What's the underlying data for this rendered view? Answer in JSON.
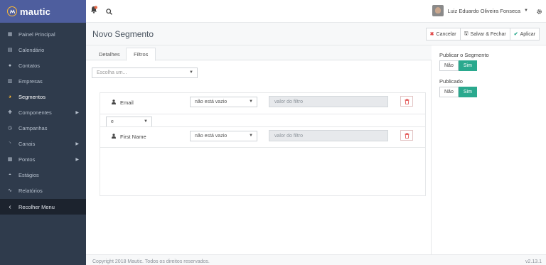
{
  "brand": {
    "name": "mautic"
  },
  "sidebar": {
    "items": [
      {
        "label": "Painel Principal",
        "icon": "dashboard-icon",
        "glyph": "▦",
        "active": false,
        "has_caret": false
      },
      {
        "label": "Calendário",
        "icon": "calendar-icon",
        "glyph": "▤",
        "active": false,
        "has_caret": false
      },
      {
        "label": "Contatos",
        "icon": "user-icon",
        "glyph": "●",
        "active": false,
        "has_caret": false
      },
      {
        "label": "Empresas",
        "icon": "building-icon",
        "glyph": "▥",
        "active": false,
        "has_caret": false
      },
      {
        "label": "Segmentos",
        "icon": "pie-chart-icon",
        "glyph": "◕",
        "active": true,
        "has_caret": false
      },
      {
        "label": "Componentes",
        "icon": "puzzle-icon",
        "glyph": "✚",
        "active": false,
        "has_caret": true
      },
      {
        "label": "Campanhas",
        "icon": "clock-icon",
        "glyph": "◷",
        "active": false,
        "has_caret": false
      },
      {
        "label": "Canais",
        "icon": "rss-icon",
        "glyph": "◝",
        "active": false,
        "has_caret": true
      },
      {
        "label": "Pontos",
        "icon": "calculator-icon",
        "glyph": "▩",
        "active": false,
        "has_caret": true
      },
      {
        "label": "Estágios",
        "icon": "tachometer-icon",
        "glyph": "◓",
        "active": false,
        "has_caret": false
      },
      {
        "label": "Relatórios",
        "icon": "line-chart-icon",
        "glyph": "∿",
        "active": false,
        "has_caret": false
      }
    ],
    "collapse": {
      "label": "Recolher Menu",
      "glyph": "‹"
    }
  },
  "header": {
    "user_name": "Luiz Eduardo Oliveira Fonseca"
  },
  "page": {
    "title": "Novo Segmento",
    "actions": {
      "cancel": "Cancelar",
      "save_close": "Salvar & Fechar",
      "apply": "Aplicar"
    }
  },
  "tabs": [
    {
      "label": "Detalhes",
      "active": false
    },
    {
      "label": "Filtros",
      "active": true
    }
  ],
  "filters": {
    "choose_placeholder": "Escolha um...",
    "rows": [
      {
        "field": "Email",
        "operator": "não está vazio",
        "value_placeholder": "valor do filtro"
      },
      {
        "field": "First Name",
        "operator": "não está vazio",
        "value_placeholder": "valor do filtro"
      }
    ],
    "glue": "e"
  },
  "right_panel": {
    "publish_segment": {
      "label": "Publicar o Segmento",
      "no": "Não",
      "yes": "Sim",
      "selected": "Sim"
    },
    "published": {
      "label": "Publicado",
      "no": "Não",
      "yes": "Sim",
      "selected": "Sim"
    }
  },
  "footer": {
    "copyright": "Copyright 2018 Mautic. Todos os direitos reservados.",
    "version": "v2.13.1"
  },
  "colors": {
    "sidebar_bg": "#2f3b4c",
    "brand_bg": "#4e5e9e",
    "accent": "#fdb933",
    "success": "#2aa98e",
    "danger": "#e14b4b"
  }
}
